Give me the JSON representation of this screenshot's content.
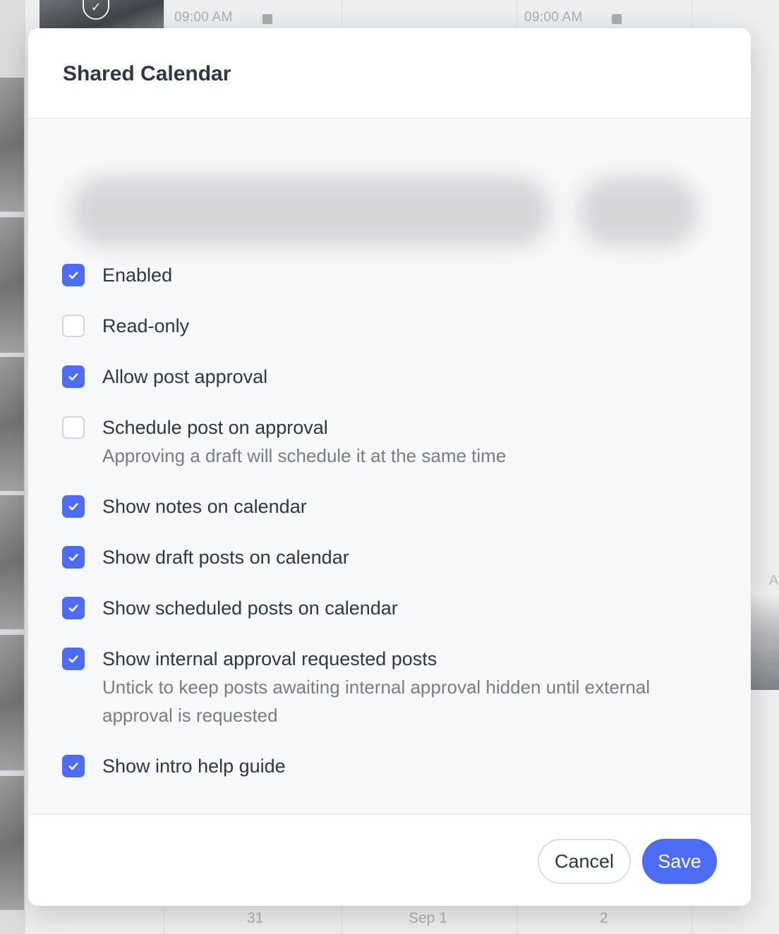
{
  "background": {
    "times": [
      "09:00 AM",
      "09:00 AM"
    ],
    "day_numbers": [
      "31",
      "Sep 1",
      "2"
    ],
    "edge_fragment": "AM"
  },
  "modal": {
    "title": "Shared Calendar",
    "options": [
      {
        "label": "Enabled",
        "checked": true,
        "description": ""
      },
      {
        "label": "Read-only",
        "checked": false,
        "description": ""
      },
      {
        "label": "Allow post approval",
        "checked": true,
        "description": ""
      },
      {
        "label": "Schedule post on approval",
        "checked": false,
        "description": "Approving a draft will schedule it at the same time"
      },
      {
        "label": "Show notes on calendar",
        "checked": true,
        "description": ""
      },
      {
        "label": "Show draft posts on calendar",
        "checked": true,
        "description": ""
      },
      {
        "label": "Show scheduled posts on calendar",
        "checked": true,
        "description": ""
      },
      {
        "label": "Show internal approval requested posts",
        "checked": true,
        "description": "Untick to keep posts awaiting internal approval hidden until external approval is requested"
      },
      {
        "label": "Show intro help guide",
        "checked": true,
        "description": ""
      }
    ],
    "cancel_label": "Cancel",
    "save_label": "Save"
  },
  "colors": {
    "accent": "#4d6cf5",
    "text": "#2f3645",
    "muted": "#777d87"
  }
}
